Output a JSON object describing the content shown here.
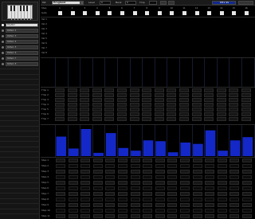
{
  "sidebar": {
    "tracks": [
      {
        "name": "Rhythm",
        "selected": true
      },
      {
        "name": "Pattern 2",
        "selected": false
      },
      {
        "name": "Pattern 3",
        "selected": false
      },
      {
        "name": "Pattern 4",
        "selected": false
      },
      {
        "name": "Pattern 5",
        "selected": false
      },
      {
        "name": "Pattern 6",
        "selected": false
      },
      {
        "name": "Pattern 7",
        "selected": false
      },
      {
        "name": "Pattern 8",
        "selected": false
      }
    ]
  },
  "topbar": {
    "label1": "Pat",
    "pattern_name": "Progland",
    "level_label": "Level",
    "level_value": "1",
    "bank_label": "Bank",
    "bank_value": "1",
    "tempo_label": "Tmp",
    "bank_display": "MT1 SS"
  },
  "grid": {
    "columns": [
      "1",
      "2",
      "3",
      "4",
      "5",
      "6",
      "7",
      "8",
      "9",
      "10",
      "11",
      "12",
      "13",
      "14",
      "15",
      "16"
    ],
    "row_labels_top": [
      "Vel 1",
      "Vel 2",
      "Vel 3",
      "Vel 4",
      "Vel 5",
      "Vel 6",
      "Vel 7",
      "Vel 8"
    ],
    "row_labels_mid": [
      "Tmp 1",
      "Tmp 2",
      "Tmp 3",
      "Tmp 4",
      "Tmp 5",
      "Tmp 6",
      "Tmp 7"
    ],
    "row_labels_bot": [
      "Step 1",
      "Step 2",
      "Step 3",
      "Step 4",
      "Step 5",
      "Step 6",
      "Step 7",
      "Step 8",
      "Step 9",
      "Step 10",
      "Step 11"
    ]
  },
  "chart_data": {
    "type": "bar",
    "categories": [
      "1",
      "2",
      "3",
      "4",
      "5",
      "6",
      "7",
      "8",
      "9",
      "10",
      "11",
      "12",
      "13",
      "14",
      "15",
      "16"
    ],
    "values": [
      0.72,
      0.28,
      1.0,
      0.12,
      0.85,
      0.3,
      0.2,
      0.58,
      0.55,
      0.14,
      0.5,
      0.45,
      0.95,
      0.2,
      0.58,
      0.7
    ],
    "ylim": [
      0,
      1
    ]
  },
  "colors": {
    "accent": "#1428c8",
    "selected_bank": "#102a8e"
  }
}
